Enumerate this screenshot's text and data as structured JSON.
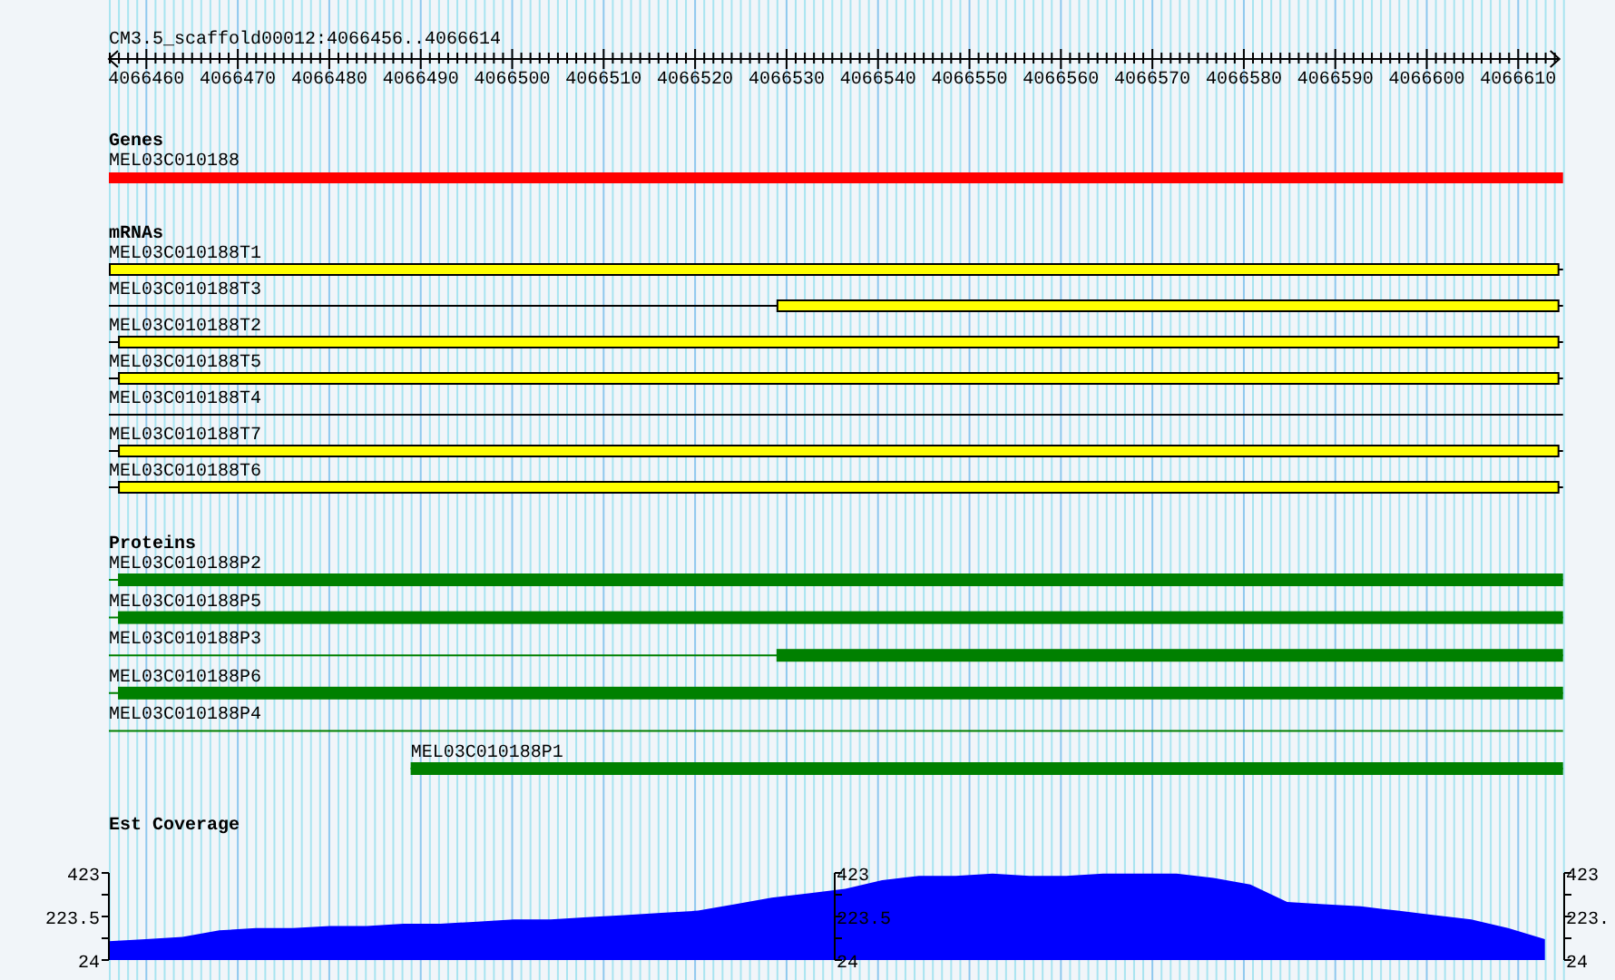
{
  "ruler": {
    "title": "CM3.5_scaffold00012:4066456..4066614",
    "ticks": [
      "4066460",
      "4066470",
      "4066480",
      "4066490",
      "4066500",
      "4066510",
      "4066520",
      "4066530",
      "4066540",
      "4066550",
      "4066560",
      "4066570",
      "4066580",
      "4066590",
      "4066600",
      "4066610"
    ]
  },
  "tracks": [
    {
      "title": "Genes",
      "kind": "gene",
      "color": "#ff0000",
      "features": [
        {
          "name": "MEL03C010188",
          "kind": "full"
        }
      ]
    },
    {
      "title": "mRNAs",
      "kind": "mrna",
      "color": "#ffff00",
      "features": [
        {
          "name": "MEL03C010188T1",
          "kind": "full"
        },
        {
          "name": "MEL03C010188T3",
          "kind": "split"
        },
        {
          "name": "MEL03C010188T2",
          "kind": "offset"
        },
        {
          "name": "MEL03C010188T5",
          "kind": "offset"
        },
        {
          "name": "MEL03C010188T4",
          "kind": "line"
        },
        {
          "name": "MEL03C010188T7",
          "kind": "offset"
        },
        {
          "name": "MEL03C010188T6",
          "kind": "offset"
        }
      ]
    },
    {
      "title": "Proteins",
      "kind": "protein",
      "color": "#008000",
      "features": [
        {
          "name": "MEL03C010188P2",
          "kind": "offset"
        },
        {
          "name": "MEL03C010188P5",
          "kind": "offset"
        },
        {
          "name": "MEL03C010188P3",
          "kind": "split"
        },
        {
          "name": "MEL03C010188P6",
          "kind": "offset"
        },
        {
          "name": "MEL03C010188P4",
          "kind": "line"
        },
        {
          "name": "MEL03C010188P1",
          "kind": "shifted"
        }
      ]
    }
  ],
  "coverage": {
    "chart_data": {
      "type": "area",
      "title": "Est Coverage",
      "series": [
        {
          "color": "#0000ff",
          "values": [
            110,
            120,
            130,
            160,
            170,
            170,
            180,
            180,
            190,
            190,
            200,
            210,
            210,
            220,
            230,
            240,
            250,
            280,
            310,
            330,
            350,
            390,
            410,
            410,
            420,
            410,
            410,
            420,
            420,
            420,
            400,
            370,
            290,
            280,
            270,
            250,
            230,
            210,
            170,
            120
          ]
        }
      ],
      "ylim": [
        24,
        423
      ],
      "yticks": [
        24,
        223.5,
        423
      ]
    },
    "middle_axis": {
      "labels": [
        "423",
        "223.5",
        "24"
      ]
    },
    "right_axis": {
      "labels": [
        "423",
        "223.",
        "24"
      ]
    }
  }
}
